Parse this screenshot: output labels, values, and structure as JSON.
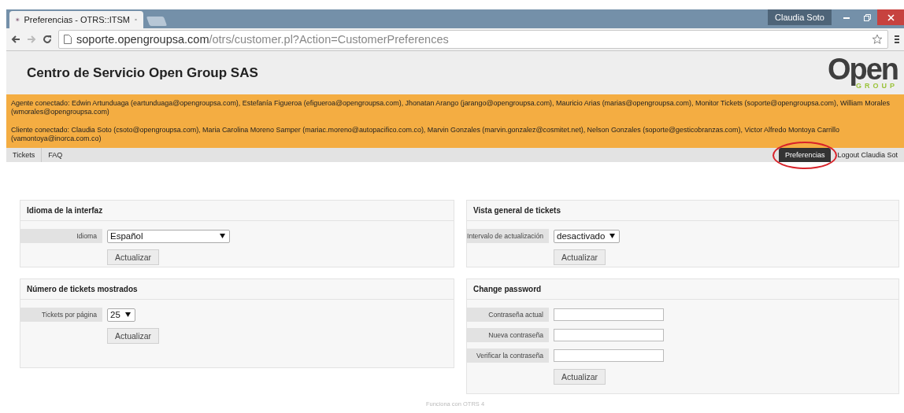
{
  "browser": {
    "tab_title": "Preferencias - OTRS::ITSM",
    "user_badge": "Claudia Soto",
    "url_host": "soporte.opengroupsa.com",
    "url_path": "/otrs/customer.pl?Action=CustomerPreferences"
  },
  "header": {
    "title": "Centro de Servicio Open Group SAS",
    "logo_word": "Open",
    "logo_sub": "GROUP"
  },
  "notices": [
    "Agente conectado: Edwin Artunduaga (eartunduaga@opengroupsa.com), Estefanía Figueroa (efigueroa@opengroupsa.com), Jhonatan Arango (jarango@opengroupsa.com), Mauricio Arias (marias@opengroupsa.com), Monitor Tickets (soporte@opengroupsa.com), William Morales (wmorales@opengroupsa.com)",
    "Cliente conectado: Claudia Soto (csoto@opengroupsa.com), Maria Carolina Moreno Samper (mariac.moreno@autopacifico.com.co), Marvin Gonzales (marvin.gonzalez@cosmitet.net), Nelson Gonzales (soporte@gesticobranzas.com), Victor Alfredo Montoya Carrillo (vamontoya@inorca.com.co)"
  ],
  "nav": {
    "items": [
      {
        "label": "Tickets",
        "selected": false
      },
      {
        "label": "FAQ",
        "selected": false
      }
    ],
    "right_items": [
      {
        "label": "Preferencias",
        "selected": true,
        "circled": true
      },
      {
        "label": "Logout Claudia Sot",
        "selected": false,
        "circled": false
      }
    ]
  },
  "panels": [
    {
      "title": "Idioma de la interfaz",
      "rows": [
        {
          "kind": "select",
          "label": "Idioma",
          "value": "Español",
          "wide": true
        }
      ],
      "button": "Actualizar"
    },
    {
      "title": "Vista general de tickets",
      "rows": [
        {
          "kind": "select",
          "label": "Intervalo de actualización",
          "value": "desactivado",
          "wide": false
        }
      ],
      "button": "Actualizar"
    },
    {
      "title": "Número de tickets mostrados",
      "rows": [
        {
          "kind": "select",
          "label": "Tickets por página",
          "value": "25",
          "wide": false
        }
      ],
      "button": "Actualizar"
    },
    {
      "title": "Change password",
      "rows": [
        {
          "kind": "input",
          "label": "Contraseña actual"
        },
        {
          "kind": "input",
          "label": "Nueva contraseña"
        },
        {
          "kind": "input",
          "label": "Verificar la contraseña"
        }
      ],
      "button": "Actualizar"
    }
  ],
  "footer": "Funciona con OTRS 4"
}
